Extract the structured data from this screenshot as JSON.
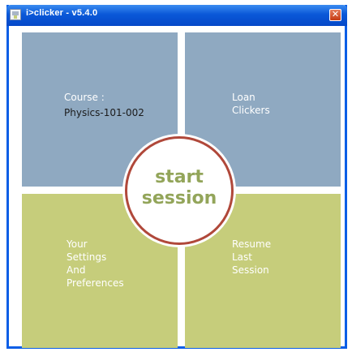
{
  "window": {
    "title": "i>clicker - v5.4.0",
    "close_label": "✕"
  },
  "tiles": {
    "course": {
      "label": "Course :",
      "value": "Physics-101-002"
    },
    "loan": {
      "lines": [
        "Loan",
        "Clickers"
      ]
    },
    "settings": {
      "lines": [
        "Your",
        "Settings",
        "And",
        "Preferences"
      ]
    },
    "resume": {
      "lines": [
        "Resume",
        "Last",
        "Session"
      ]
    }
  },
  "start_button": {
    "line1": "start",
    "line2": "session"
  },
  "colors": {
    "titlebar": "#0a58d8",
    "blue_tile": "#8fa9c1",
    "green_tile": "#c6cd7b",
    "start_ring": "#b0483a",
    "start_text": "#93a55a"
  }
}
